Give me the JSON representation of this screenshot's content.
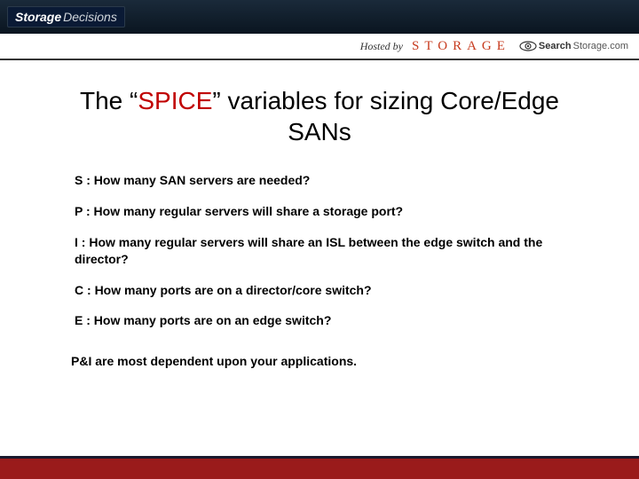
{
  "header": {
    "logo_storage": "Storage",
    "logo_decisions": "Decisions"
  },
  "subheader": {
    "hosted_by": "Hosted by",
    "storage_brand": "STORAGE",
    "search_brand_bold": "Search",
    "search_brand_light": "Storage.com"
  },
  "title": {
    "pre": "The “",
    "spice": "SPICE",
    "post": "” variables for sizing Core/Edge SANs"
  },
  "items": [
    {
      "letter": "S",
      "text": " : How many SAN servers are needed?"
    },
    {
      "letter": "P",
      "text": " : How many regular servers will share a storage port?"
    },
    {
      "letter": "I",
      "text": " : How many regular servers will share an ISL between the edge switch and the director?"
    },
    {
      "letter": "C",
      "text": " : How many ports are on a director/core switch?"
    },
    {
      "letter": "E",
      "text": " : How many ports are on an edge switch?"
    }
  ],
  "note": "P&I are most dependent upon your applications."
}
